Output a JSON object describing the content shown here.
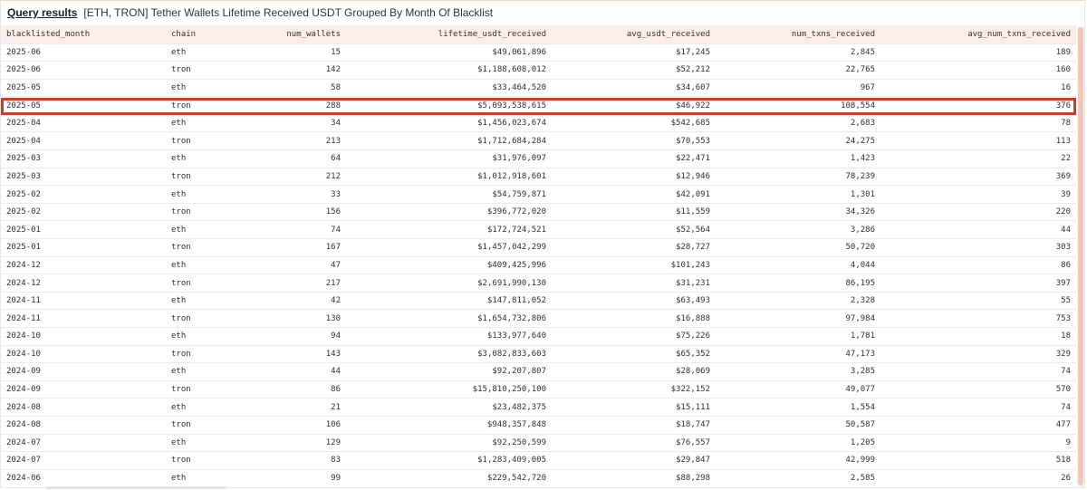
{
  "header": {
    "link_label": "Query results",
    "title": "[ETH, TRON] Tether Wallets Lifetime Received USDT Grouped By Month Of Blacklist"
  },
  "table": {
    "columns": [
      "blacklisted_month",
      "chain",
      "num_wallets",
      "lifetime_usdt_received",
      "avg_usdt_received",
      "num_txns_received",
      "avg_num_txns_received"
    ],
    "highlighted_row_index": 3,
    "highlight_color": "#d33a2c",
    "header_bg": "#fbeee9",
    "rows": [
      [
        "2025-06",
        "eth",
        "15",
        "$49,061,896",
        "$17,245",
        "2,845",
        "189"
      ],
      [
        "2025-06",
        "tron",
        "142",
        "$1,188,608,012",
        "$52,212",
        "22,765",
        "160"
      ],
      [
        "2025-05",
        "eth",
        "58",
        "$33,464,520",
        "$34,607",
        "967",
        "16"
      ],
      [
        "2025-05",
        "tron",
        "288",
        "$5,093,538,615",
        "$46,922",
        "108,554",
        "376"
      ],
      [
        "2025-04",
        "eth",
        "34",
        "$1,456,023,674",
        "$542,685",
        "2,683",
        "78"
      ],
      [
        "2025-04",
        "tron",
        "213",
        "$1,712,684,284",
        "$70,553",
        "24,275",
        "113"
      ],
      [
        "2025-03",
        "eth",
        "64",
        "$31,976,097",
        "$22,471",
        "1,423",
        "22"
      ],
      [
        "2025-03",
        "tron",
        "212",
        "$1,012,918,601",
        "$12,946",
        "78,239",
        "369"
      ],
      [
        "2025-02",
        "eth",
        "33",
        "$54,759,871",
        "$42,091",
        "1,301",
        "39"
      ],
      [
        "2025-02",
        "tron",
        "156",
        "$396,772,020",
        "$11,559",
        "34,326",
        "220"
      ],
      [
        "2025-01",
        "eth",
        "74",
        "$172,724,521",
        "$52,564",
        "3,286",
        "44"
      ],
      [
        "2025-01",
        "tron",
        "167",
        "$1,457,042,299",
        "$28,727",
        "50,720",
        "303"
      ],
      [
        "2024-12",
        "eth",
        "47",
        "$409,425,996",
        "$101,243",
        "4,044",
        "86"
      ],
      [
        "2024-12",
        "tron",
        "217",
        "$2,691,990,130",
        "$31,231",
        "86,195",
        "397"
      ],
      [
        "2024-11",
        "eth",
        "42",
        "$147,811,052",
        "$63,493",
        "2,328",
        "55"
      ],
      [
        "2024-11",
        "tron",
        "130",
        "$1,654,732,806",
        "$16,888",
        "97,984",
        "753"
      ],
      [
        "2024-10",
        "eth",
        "94",
        "$133,977,640",
        "$75,226",
        "1,781",
        "18"
      ],
      [
        "2024-10",
        "tron",
        "143",
        "$3,082,833,603",
        "$65,352",
        "47,173",
        "329"
      ],
      [
        "2024-09",
        "eth",
        "44",
        "$92,207,807",
        "$28,069",
        "3,285",
        "74"
      ],
      [
        "2024-09",
        "tron",
        "86",
        "$15,810,250,100",
        "$322,152",
        "49,077",
        "570"
      ],
      [
        "2024-08",
        "eth",
        "21",
        "$23,482,375",
        "$15,111",
        "1,554",
        "74"
      ],
      [
        "2024-08",
        "tron",
        "106",
        "$948,357,848",
        "$18,747",
        "50,587",
        "477"
      ],
      [
        "2024-07",
        "eth",
        "129",
        "$92,250,599",
        "$76,557",
        "1,205",
        "9"
      ],
      [
        "2024-07",
        "tron",
        "83",
        "$1,283,409,005",
        "$29,847",
        "42,999",
        "518"
      ],
      [
        "2024-06",
        "eth",
        "99",
        "$229,542,720",
        "$88,298",
        "2,585",
        "26"
      ]
    ]
  }
}
